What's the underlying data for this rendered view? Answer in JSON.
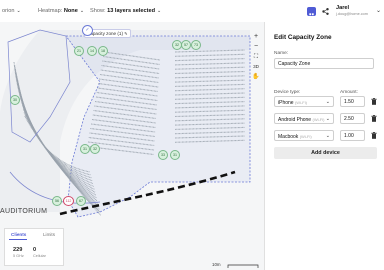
{
  "topbar": {
    "crumb": "orion",
    "heatmap_label": "Heatmap:",
    "heatmap_value": "None",
    "show_label": "Show:",
    "show_value": "13 layers selected",
    "user_name": "Jarel",
    "user_email": "j.doug@home.com"
  },
  "map": {
    "zone_tag": "Capacity zone (1)",
    "auditorium_label": "AUDITORIUM",
    "scale_label": "10m",
    "zoom_in": "+",
    "zoom_out": "−",
    "view3d": "3D",
    "badges": [
      "32",
      "57",
      "73",
      "21",
      "14",
      "18",
      "30",
      "31",
      "32",
      "33",
      "31",
      "56",
      "112",
      "67"
    ],
    "tabs": [
      "Clients",
      "Limits"
    ],
    "stats": [
      {
        "value": "229",
        "label": "5 GHz"
      },
      {
        "value": "0",
        "label": "Cellular"
      }
    ]
  },
  "panel": {
    "title": "Edit Capacity Zone",
    "name_label": "Name:",
    "name_value": "Capacity Zone",
    "device_type_label": "Device type:",
    "amount_label": "Amount:",
    "devices": [
      {
        "type": "iPhone",
        "hint": "(Wi-Fi)",
        "amount": "1.50"
      },
      {
        "type": "Android Phone",
        "hint": "(Wi-Fi)",
        "amount": "2.50"
      },
      {
        "type": "Macbook",
        "hint": "(Wi-Fi)",
        "amount": "1.00"
      }
    ],
    "add_device": "Add device"
  },
  "colors": {
    "accent": "#4f5bd5",
    "zone": "#6b7ad6",
    "badge_bg": "#d8f0dd",
    "seat": "#9aa3ad"
  }
}
